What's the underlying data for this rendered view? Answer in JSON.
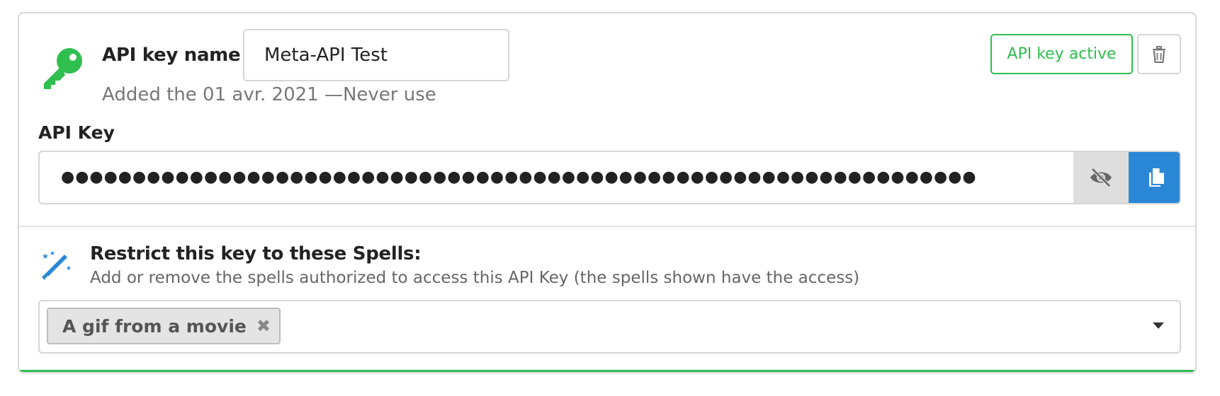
{
  "api_key": {
    "name_label": "API key name",
    "required_marker": "*",
    "name_value": "Meta-API Test",
    "added_info": "Added the 01 avr. 2021 —Never use",
    "status_label": "API key active",
    "key_label": "API Key",
    "masked_value": "●●●●●●●●●●●●●●●●●●●●●●●●●●●●●●●●●●●●●●●●●●●●●●●●●●●●●●●●●●●●●●●●"
  },
  "restrict": {
    "title": "Restrict this key to these Spells:",
    "subtitle": "Add or remove the spells authorized to access this API Key (the spells shown have the access)",
    "selected_spells": [
      {
        "label": "A gif from a movie",
        "remove_glyph": "✖"
      }
    ]
  },
  "colors": {
    "accent_green": "#2fbf4f",
    "accent_blue": "#2a87d6",
    "required_red": "#d33"
  },
  "icons": {
    "key": "key-icon",
    "delete": "trash-icon",
    "visibility": "eye-slash-icon",
    "copy": "copy-icon",
    "wand": "magic-wand-icon",
    "dropdown": "caret-down-icon"
  }
}
